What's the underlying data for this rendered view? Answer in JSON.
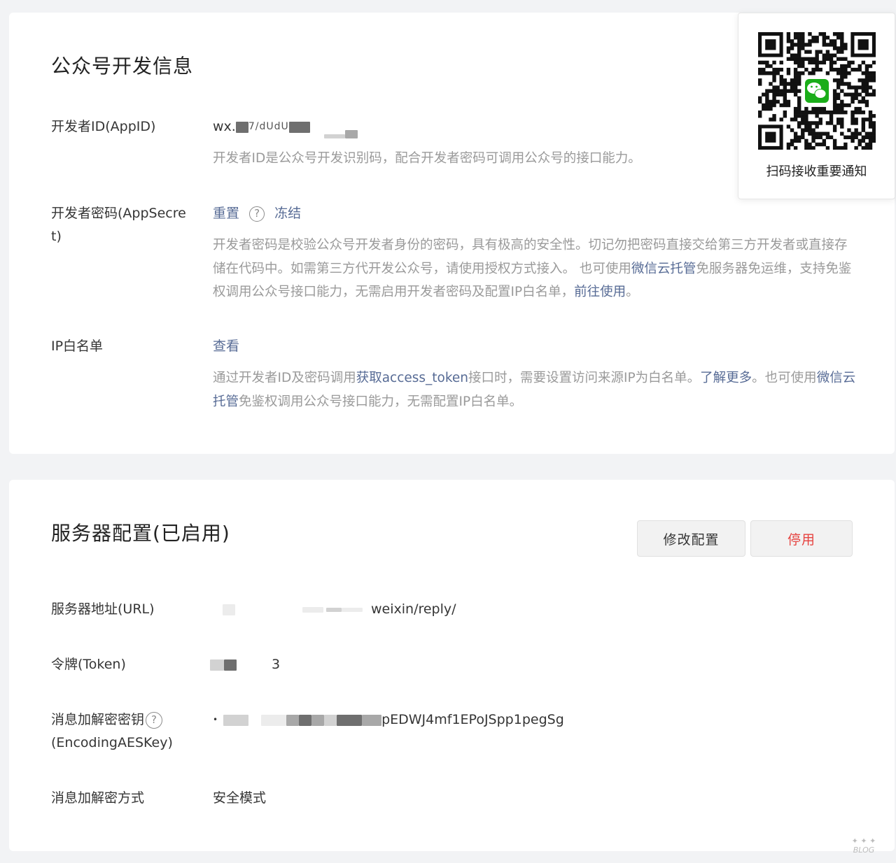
{
  "dev_info": {
    "title": "公众号开发信息",
    "appid": {
      "label": "开发者ID(AppID)",
      "value_prefix": "wx.",
      "value_fragment": "7/dUdU",
      "desc": "开发者ID是公众号开发识别码，配合开发者密码可调用公众号的接口能力。"
    },
    "appsecret": {
      "label": "开发者密码(AppSecret)",
      "reset": "重置",
      "freeze": "冻结",
      "desc_part1": "开发者密码是校验公众号开发者身份的密码，具有极高的安全性。切记勿把密码直接交给第三方开发者或直接存储在代码中。如需第三方代开发公众号，请使用授权方式接入。 也可使用",
      "desc_link1": "微信云托管",
      "desc_part2": "免服务器免运维，支持免鉴权调用公众号接口能力，无需启用开发者密码及配置IP白名单，",
      "desc_link2": "前往使用",
      "desc_part3": "。"
    },
    "ip_whitelist": {
      "label": "IP白名单",
      "view": "查看",
      "desc_part1": "通过开发者ID及密码调用",
      "desc_link1": "获取access_token",
      "desc_part2": "接口时，需要设置访问来源IP为白名单。",
      "desc_link2": "了解更多",
      "desc_part3": "。也可使用",
      "desc_link3": "微信云托管",
      "desc_part4": "免鉴权调用公众号接口能力，无需配置IP白名单。"
    }
  },
  "qr": {
    "caption": "扫码接收重要通知",
    "icon": "wechat-icon"
  },
  "server": {
    "title": "服务器配置(已启用)",
    "modify_button": "修改配置",
    "disable_button": "停用",
    "url": {
      "label": "服务器地址(URL)",
      "value_suffix": "weixin/reply/"
    },
    "token": {
      "label": "令牌(Token)",
      "value_suffix": "3"
    },
    "aes_key": {
      "label_line1": "消息加解密密钥",
      "label_line2": "(EncodingAESKey)",
      "value_suffix": "pEDWJ4mf1EPoJSpp1pegSg"
    },
    "encrypt_mode": {
      "label": "消息加解密方式",
      "value": "安全模式"
    }
  },
  "colors": {
    "link": "#576b95",
    "danger": "#e64340",
    "muted_text": "#9a9a9a",
    "wechat_green": "#1aad19"
  },
  "watermark": "BLOG"
}
